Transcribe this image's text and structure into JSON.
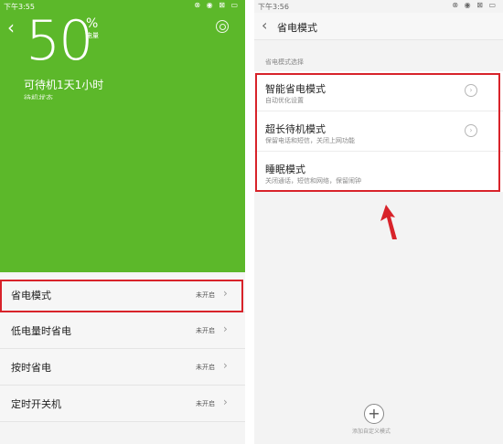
{
  "left_screen": {
    "status": {
      "time": "下午3:55",
      "icons": "⊗ ◉ ⊠ ▭"
    },
    "battery_percent": "50",
    "percent_sign": "%",
    "battery_label": "电量",
    "standby": "可待机1天1小时",
    "standby_sub": "待机状态",
    "items": [
      {
        "label": "省电模式",
        "state": "未开启"
      },
      {
        "label": "低电量时省电",
        "state": "未开启"
      },
      {
        "label": "按时省电",
        "state": "未开启"
      },
      {
        "label": "定时开关机",
        "state": "未开启"
      }
    ]
  },
  "right_screen": {
    "status": {
      "time": "下午3:56",
      "icons": "⊗ ◉ ⊠ ▭"
    },
    "title": "省电模式",
    "section_label": "省电模式选择",
    "options": [
      {
        "title": "智能省电模式",
        "desc": "自动优化设置"
      },
      {
        "title": "超长待机模式",
        "desc": "保留电话和短信，关闭上网功能"
      },
      {
        "title": "睡眠模式",
        "desc": "关闭通话，短信和网络，保留闹钟"
      }
    ],
    "add_label": "添加自定义模式"
  },
  "colors": {
    "green": "#5cb82a",
    "highlight": "#d8232a"
  }
}
